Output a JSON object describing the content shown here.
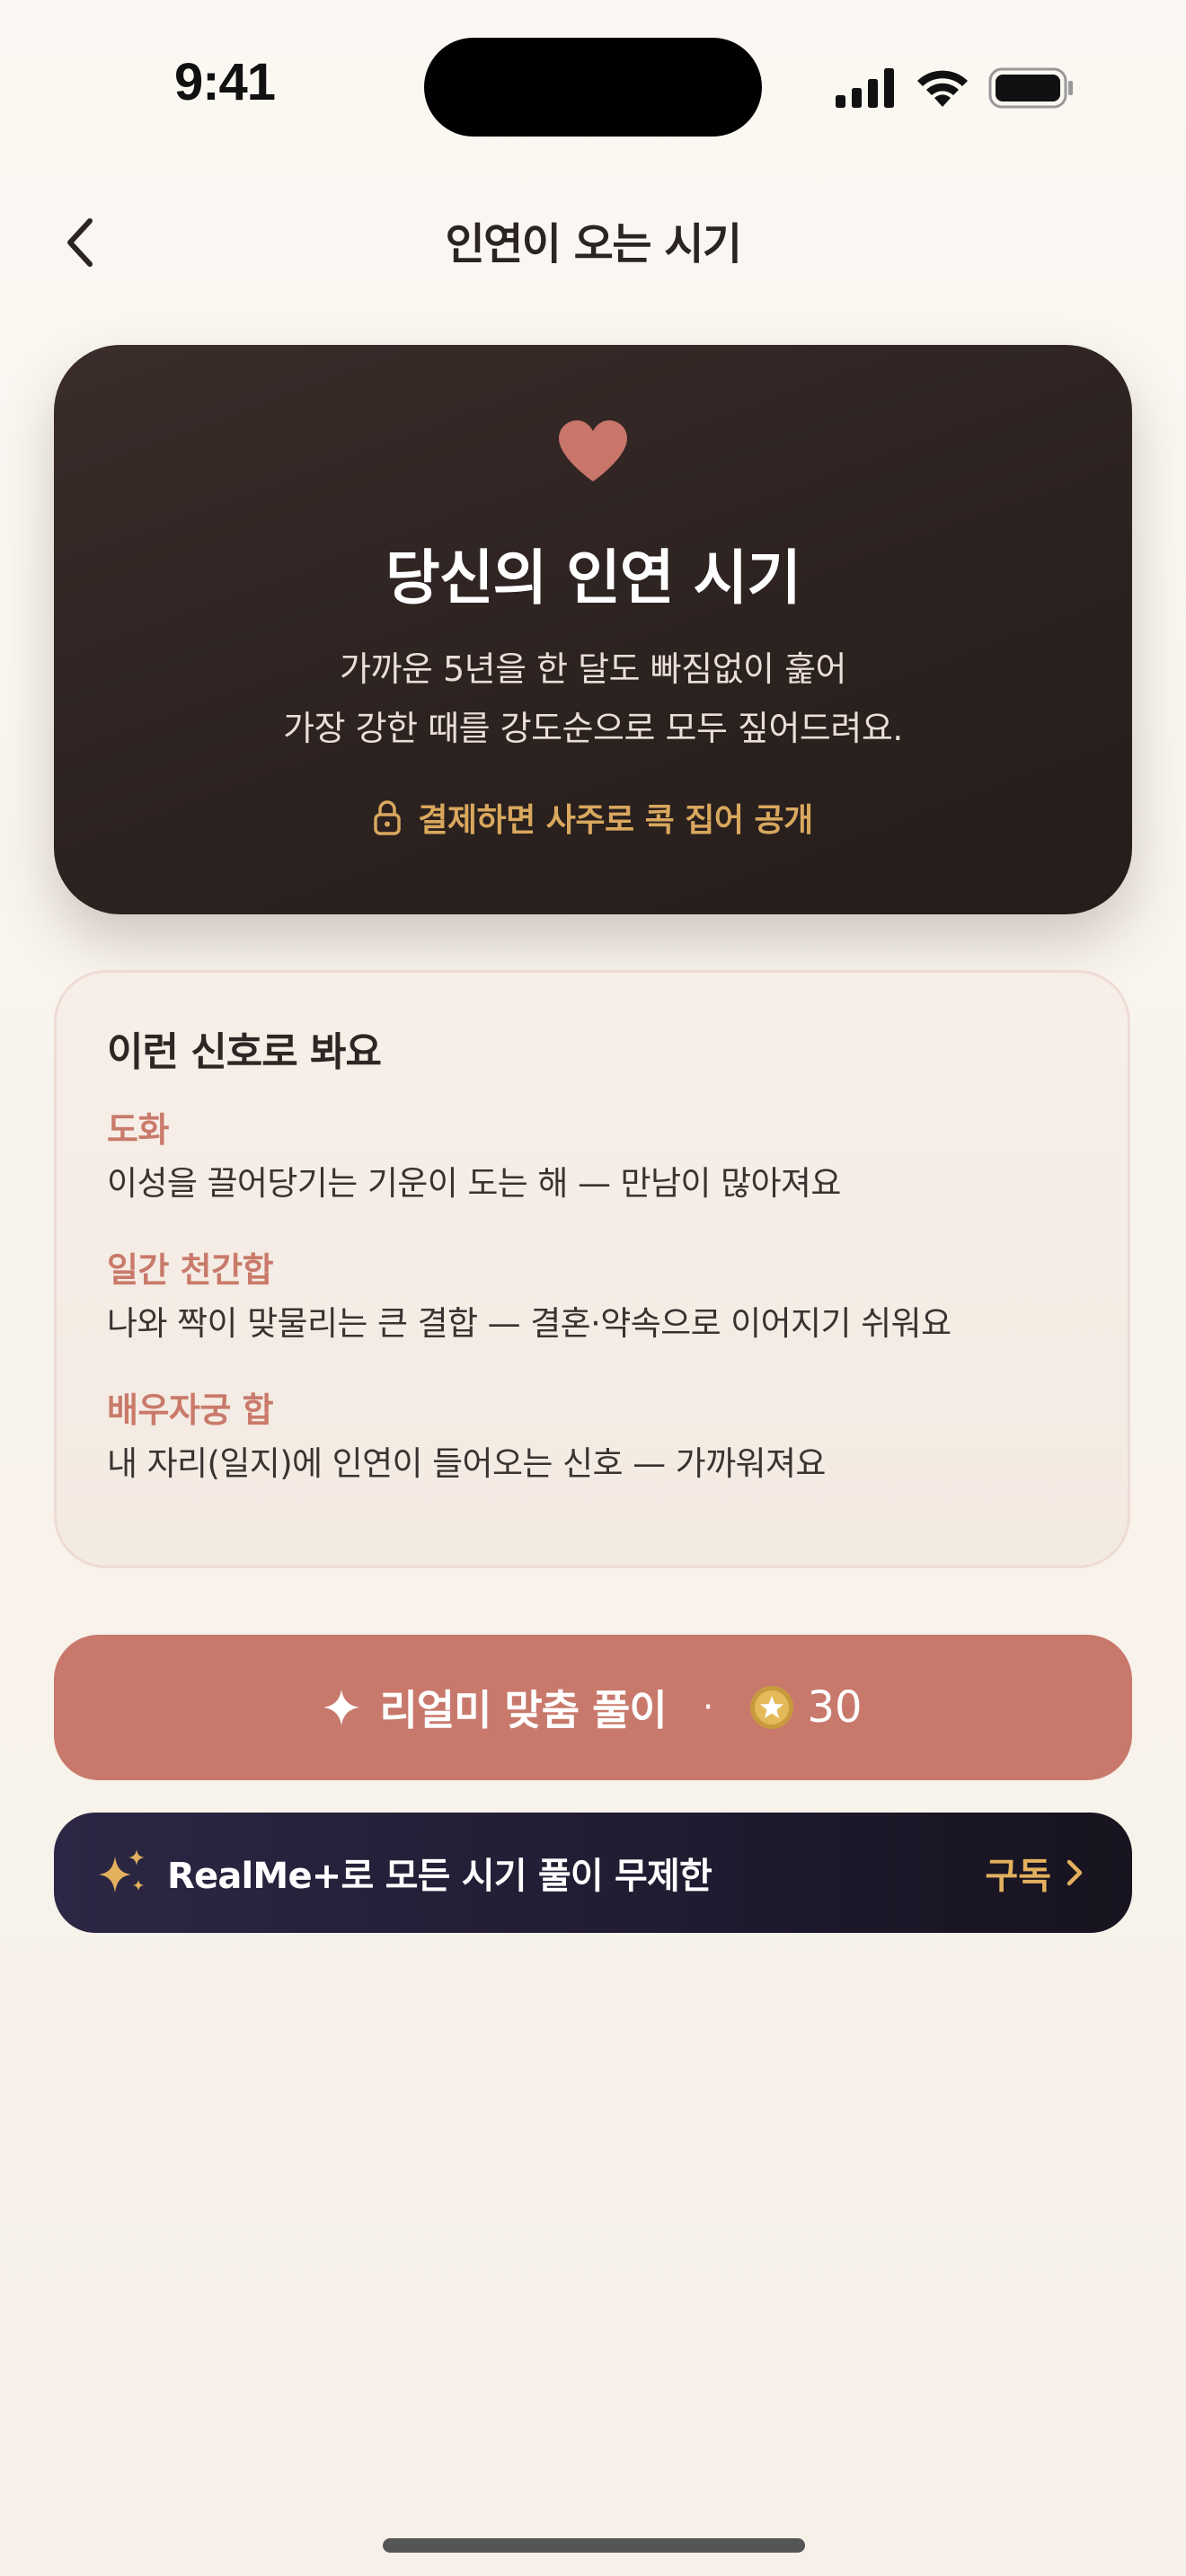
{
  "status_bar": {
    "time": "9:41"
  },
  "nav": {
    "title": "인연이 오는 시기"
  },
  "hero": {
    "title": "당신의 인연 시기",
    "description_lines": [
      "가까운 5년을 한 달도 빠짐없이 훑어",
      "가장 강한 때를 강도순으로 모두 짚어드려요."
    ],
    "lock_text": "결제하면 사주로 콕 집어 공개",
    "colors": {
      "heart": "#C8766A",
      "lock_accent": "#D9A85E",
      "card_bg": "#2C2220"
    }
  },
  "signals": {
    "title": "이런 신호로 봐요",
    "items": [
      {
        "name": "도화",
        "desc": "이성을 끌어당기는 기운이 도는 해 — 만남이 많아져요"
      },
      {
        "name": "일간 천간합",
        "desc": "나와 짝이 맞물리는 큰 결합 — 결혼·약속으로 이어지기 쉬워요"
      },
      {
        "name": "배우자궁 합",
        "desc": "내 자리(일지)에 인연이 들어오는 신호 — 가까워져요"
      }
    ],
    "accent_color": "#C97A6A"
  },
  "primary_button": {
    "label": "리얼미 맞춤 풀이",
    "separator": "·",
    "price": "30",
    "bg_color": "#C8796C"
  },
  "subscribe_banner": {
    "text": "RealMe+로 모든 시기 풀이 무제한",
    "action": "구독",
    "accent_color": "#E3B05E"
  },
  "icons": {
    "back": "chevron-left-icon",
    "heart": "heart-icon",
    "lock": "lock-icon",
    "sparkle": "sparkle-icon",
    "coin": "star-coin-icon",
    "sparkles": "sparkles-icon",
    "chevron_right": "chevron-right-icon"
  }
}
